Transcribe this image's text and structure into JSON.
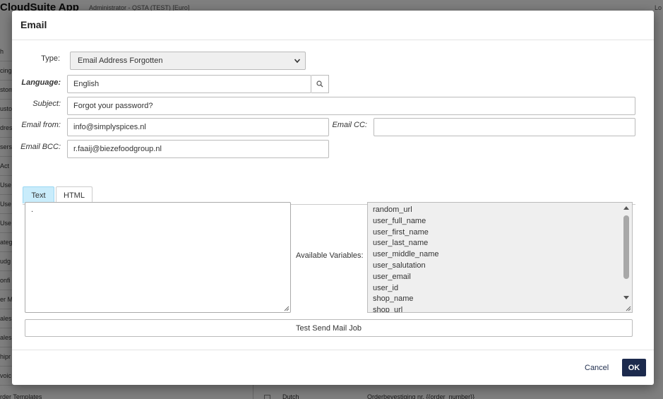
{
  "background": {
    "app_name": "CloudSuite App",
    "admin_info": "Administrator - QSTA (TEST) [Euro]",
    "top_right": "Lo",
    "sidebar_items": [
      "h",
      "cing",
      "stom",
      "usto",
      "dres",
      "sers",
      "Act",
      "Use",
      "Use",
      "Use",
      "ateg",
      "udg",
      "onfi",
      "er M",
      "ales",
      "ales",
      "hipr",
      "voic"
    ],
    "bottom_left": "rder Templates",
    "bottom_mid": "Dutch",
    "bottom_right": "Orderbevestiging nr. {{order_number}}"
  },
  "modal": {
    "title": "Email",
    "type_label": "Type:",
    "type_value": "Email Address Forgotten",
    "language_label": "Language:",
    "language_value": "English",
    "subject_label": "Subject:",
    "subject_value": "Forgot your password?",
    "email_from_label": "Email from:",
    "email_from_value": "info@simplyspices.nl",
    "email_cc_label": "Email CC:",
    "email_cc_value": "",
    "email_bcc_label": "Email BCC:",
    "email_bcc_value": "r.faaij@biezefoodgroup.nl",
    "tabs": [
      {
        "label": "Text",
        "active": true
      },
      {
        "label": "HTML",
        "active": false
      }
    ],
    "body_text": ".",
    "available_variables_label": "Available Variables:",
    "variables": [
      "random_url",
      "user_full_name",
      "user_first_name",
      "user_last_name",
      "user_middle_name",
      "user_salutation",
      "user_email",
      "user_id",
      "shop_name",
      "shop_url"
    ],
    "test_button": "Test Send Mail Job",
    "cancel_button": "Cancel",
    "ok_button": "OK"
  },
  "colors": {
    "tab_active": "#c9ecfb",
    "ok_button": "#1c2a4d",
    "overlay": "#7f7f7f"
  }
}
